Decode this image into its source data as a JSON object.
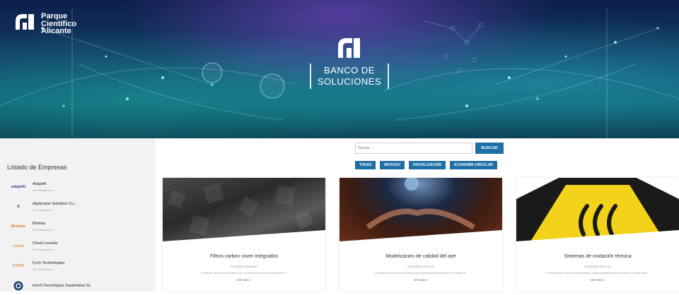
{
  "header": {
    "logo_lines": [
      "Parque",
      "Científico",
      "Alicante"
    ],
    "banner_lines": [
      "BANCO DE",
      "SOLUCIONES"
    ]
  },
  "sidebar": {
    "title": "Listado de Empresas",
    "companies": [
      {
        "logo_text": "adaptAI",
        "name": "AdaptAI",
        "link": "Ver Soluciones »",
        "color": "#3b4a9a"
      },
      {
        "logo_text": "A",
        "name": "Applynano Solutions S.L.",
        "link": "Ver Soluciones »",
        "color": "#1d4f8a"
      },
      {
        "logo_text": "Biothas",
        "name": "Biothas",
        "link": "Ver Soluciones »",
        "color": "#e07a2d"
      },
      {
        "logo_text": "cloud",
        "name": "Cloud Levante",
        "link": "Ver Soluciones »",
        "color": "#e0a22d"
      },
      {
        "logo_text": "FYCH",
        "name": "Fych Technologies",
        "link": "Ver Soluciones »",
        "color": "#d98a2a"
      },
      {
        "logo_text": "",
        "name": "Inno3 Tecnologías Sostenibles SL",
        "link": "",
        "color": "#1d3f6a"
      }
    ]
  },
  "search": {
    "placeholder": "Buscar ...",
    "button": "BUSCAR"
  },
  "filters": [
    "TODAS",
    "BIOTECH",
    "DIGITALIZACIÓN",
    "ECONOMÍA CIRCULAR"
  ],
  "cards": [
    {
      "title": "Filtros carbon cover integrados",
      "category": "ECONOMÍA CIRCULAR",
      "description": "El sistema Carbon Cover consiste en un cerramiento que confina las emisiones d...",
      "more": "VER MÁS »"
    },
    {
      "title": "Modelización de calidad del aire",
      "category": "ECONOMÍA CIRCULAR",
      "description": "La realización de estudios de dispersión de contaminantes atmosféricos con el objeto de...",
      "more": "VER MÁS »"
    },
    {
      "title": "Sistemas de oxidación térmica",
      "category": "ECONOMÍA CIRCULAR",
      "description": "Los sistemas de oxidación térmica trabajan a altas temperaturas para convertir los contaminantes...",
      "more": "VER MÁS »"
    }
  ],
  "colors": {
    "accent": "#1d6fa5",
    "sidebar_bg": "#f2f2f2"
  }
}
